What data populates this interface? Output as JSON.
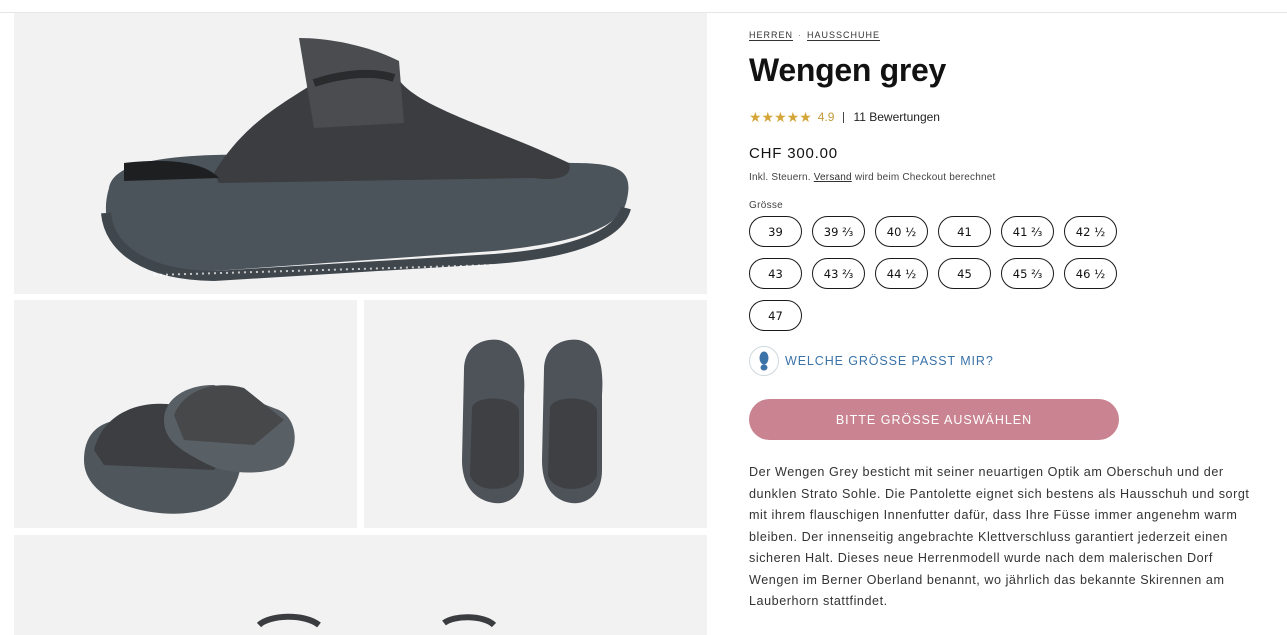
{
  "breadcrumb": [
    {
      "label": "HERREN"
    },
    {
      "label": "HAUSSCHUHE"
    }
  ],
  "breadcrumb_separator": "·",
  "product": {
    "title": "Wengen grey",
    "stars": "★★★★★",
    "rating": "4.9",
    "reviews": "11 Bewertungen",
    "price": "CHF 300.00",
    "tax_prefix": "Inkl. Steuern.",
    "tax_link": "Versand",
    "tax_suffix": "wird beim Checkout berechnet"
  },
  "size": {
    "label": "Grösse",
    "options": [
      "39",
      "39 ⅔",
      "40 ½",
      "41",
      "41 ⅔",
      "42 ½",
      "43",
      "43 ⅔",
      "44 ½",
      "45",
      "45 ⅔",
      "46 ½",
      "47"
    ]
  },
  "fit_guide": {
    "icon": "footprint-icon",
    "label": "WELCHE GRÖSSE PASST MIR?"
  },
  "cta": {
    "label": "BITTE GRÖSSE AUSWÄHLEN"
  },
  "description": "Der Wengen Grey besticht mit seiner neuartigen Optik am Oberschuh und der dunklen Strato Sohle. Die Pantolette eignet sich bestens als Hausschuh und sorgt mit ihrem flauschigen Innenfutter dafür, dass Ihre Füsse immer angenehm warm bleiben. Der innenseitig angebrachte Klettverschluss garantiert jederzeit einen sicheren Halt. Dieses neue Herrenmodell wurde nach dem malerischen Dorf Wengen im Berner Oberland benannt, wo jährlich das bekannte Skirennen am Lauberhorn stattfindet.",
  "colors": {
    "accent": "#c98391",
    "link": "#3b73a8",
    "star": "#d4a63a",
    "panel": "#f2f2f2"
  }
}
